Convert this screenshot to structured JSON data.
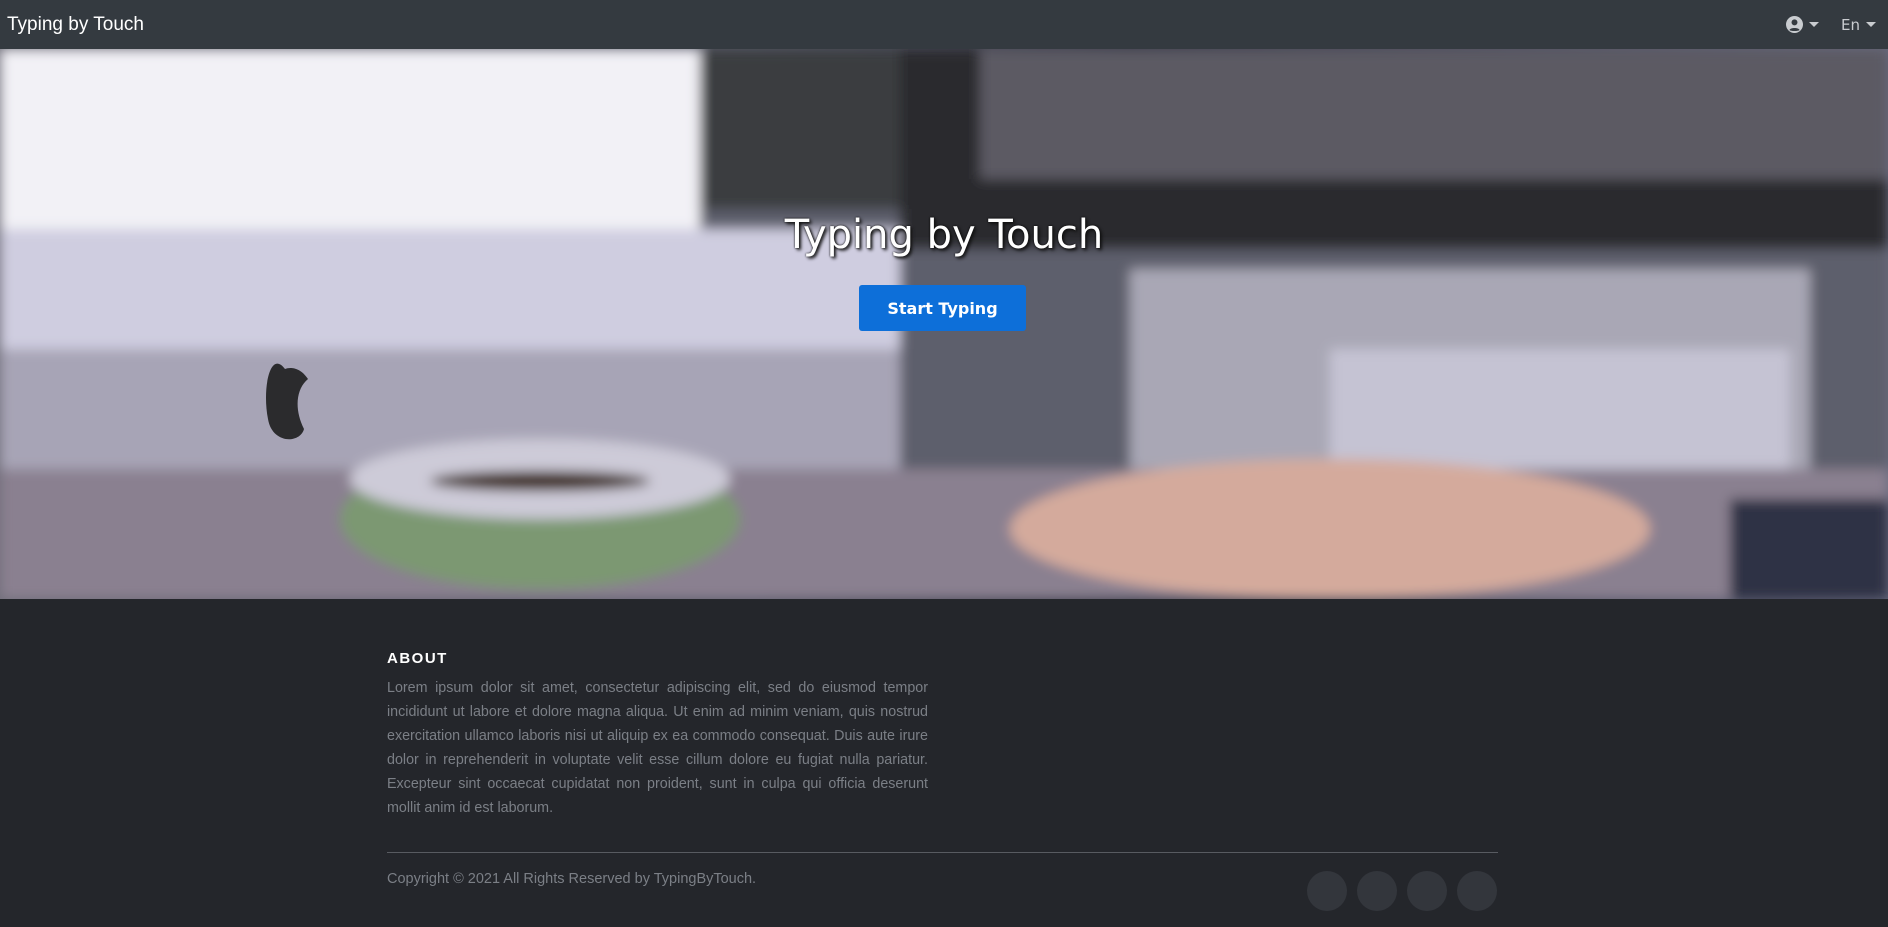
{
  "navbar": {
    "brand": "Typing by Touch",
    "user_menu_icon": "user-circle-icon",
    "language": "En"
  },
  "hero": {
    "title": "Typing by Touch",
    "cta_label": "Start Typing"
  },
  "footer": {
    "about_heading": "ABOUT",
    "about_text": "Lorem ipsum dolor sit amet, consectetur adipiscing elit, sed do eiusmod tempor incididunt ut labore et dolore magna aliqua. Ut enim ad minim veniam, quis nostrud exercitation ullamco laboris nisi ut aliquip ex ea commodo consequat. Duis aute irure dolor in reprehenderit in voluptate velit esse cillum dolore eu fugiat nulla pariatur. Excepteur sint occaecat cupidatat non proident, sunt in culpa qui officia deserunt mollit anim id est laborum.",
    "copyright": "Copyright © 2021 All Rights Reserved by TypingByTouch.",
    "social_icons": [
      "social-icon-1",
      "social-icon-2",
      "social-icon-3",
      "social-icon-4"
    ]
  },
  "colors": {
    "navbar_bg": "#343a40",
    "footer_bg": "#24262b",
    "accent": "#0d6fd9"
  }
}
